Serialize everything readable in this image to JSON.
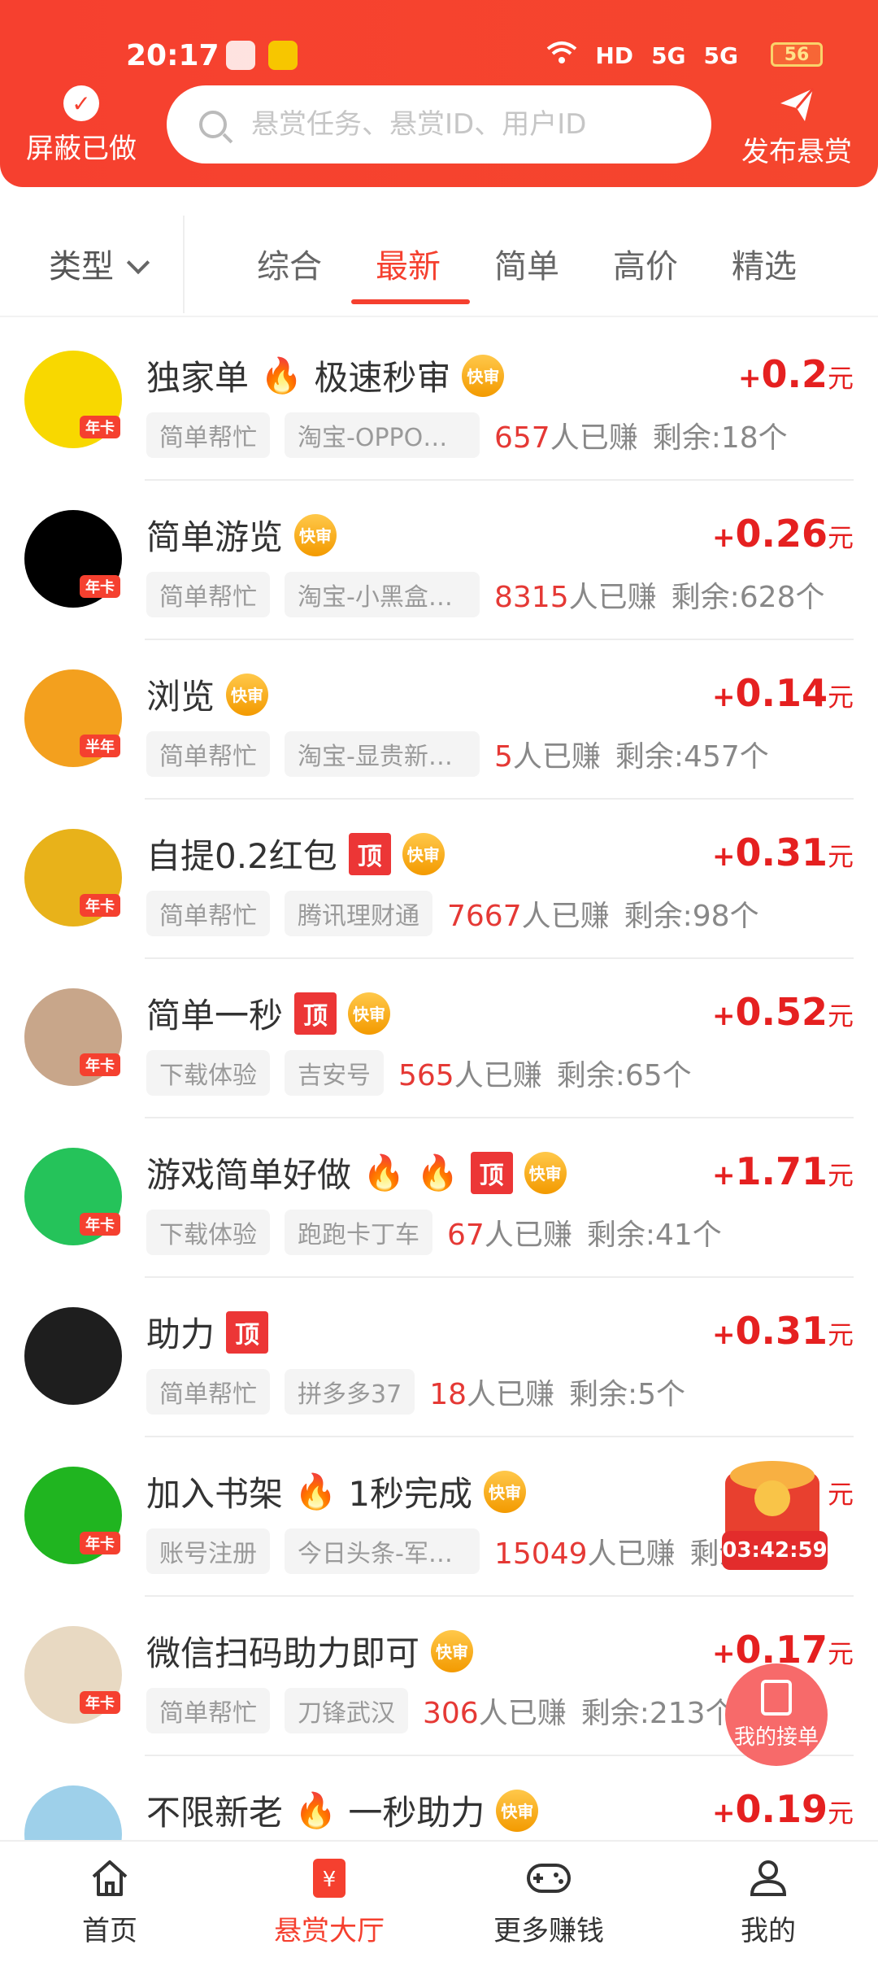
{
  "status": {
    "time": "20:17",
    "battery": "56",
    "network_labels": [
      "HD",
      "5G",
      "5G"
    ]
  },
  "header": {
    "left_label": "屏蔽已做",
    "search_placeholder": "悬赏任务、悬赏ID、用户ID",
    "right_label": "发布悬赏"
  },
  "filter": {
    "type_label": "类型",
    "tabs": [
      "综合",
      "最新",
      "简单",
      "高价",
      "精选"
    ],
    "active_tab": "最新"
  },
  "tasks": [
    {
      "title": "独家单",
      "title2": "极速秒审",
      "fire1": true,
      "fire2": false,
      "top": false,
      "quick": true,
      "tag1": "简单帮忙",
      "tag2": "淘宝-OPPO旗...",
      "earned": "657",
      "earned_suffix": "人已赚",
      "remain": "剩余:18个",
      "price": "0.2",
      "card": "年卡",
      "avatar_color": "#f8d800"
    },
    {
      "title": "简单游览",
      "title2": "",
      "fire1": false,
      "fire2": false,
      "top": false,
      "quick": true,
      "tag1": "简单帮忙",
      "tag2": "淘宝-小黑盒追...",
      "earned": "8315",
      "earned_suffix": "人已赚",
      "remain": "剩余:628个",
      "price": "0.26",
      "card": "年卡",
      "avatar_color": "#000000"
    },
    {
      "title": "浏览",
      "title2": "",
      "fire1": false,
      "fire2": false,
      "top": false,
      "quick": true,
      "tag1": "简单帮忙",
      "tag2": "淘宝-显贵新路...",
      "earned": "5",
      "earned_suffix": "人已赚",
      "remain": "剩余:457个",
      "price": "0.14",
      "card": "半年",
      "avatar_color": "#f3a01e"
    },
    {
      "title": "自提0.2红包",
      "title2": "",
      "fire1": false,
      "fire2": false,
      "top": true,
      "quick": true,
      "tag1": "简单帮忙",
      "tag2": "腾讯理财通",
      "earned": "7667",
      "earned_suffix": "人已赚",
      "remain": "剩余:98个",
      "price": "0.31",
      "card": "年卡",
      "avatar_color": "#e8b21a"
    },
    {
      "title": "简单一秒",
      "title2": "",
      "fire1": false,
      "fire2": false,
      "top": true,
      "quick": true,
      "tag1": "下载体验",
      "tag2": "吉安号",
      "earned": "565",
      "earned_suffix": "人已赚",
      "remain": "剩余:65个",
      "price": "0.52",
      "card": "年卡",
      "avatar_color": "#c8a68a"
    },
    {
      "title": "游戏简单好做",
      "title2": "",
      "fire1": true,
      "fire2": true,
      "top": true,
      "quick": true,
      "tag1": "下载体验",
      "tag2": "跑跑卡丁车",
      "earned": "67",
      "earned_suffix": "人已赚",
      "remain": "剩余:41个",
      "price": "1.71",
      "card": "年卡",
      "avatar_color": "#25c35a"
    },
    {
      "title": "助力",
      "title2": "",
      "fire1": false,
      "fire2": false,
      "top": true,
      "quick": false,
      "tag1": "简单帮忙",
      "tag2": "拼多多37",
      "earned": "18",
      "earned_suffix": "人已赚",
      "remain": "剩余:5个",
      "price": "0.31",
      "card": "",
      "avatar_color": "#1e1e1e"
    },
    {
      "title": "加入书架",
      "title2": "1秒完成",
      "fire1": true,
      "fire2": false,
      "top": false,
      "quick": true,
      "tag1": "账号注册",
      "tag2": "今日头条-军训...",
      "earned": "15049",
      "earned_suffix": "人已赚",
      "remain": "剩余:",
      "price": "",
      "card": "年卡",
      "avatar_color": "#20b520"
    },
    {
      "title": "微信扫码助力即可",
      "title2": "",
      "fire1": false,
      "fire2": false,
      "top": false,
      "quick": true,
      "tag1": "简单帮忙",
      "tag2": "刀锋武汉",
      "earned": "306",
      "earned_suffix": "人已赚",
      "remain": "剩余:213个",
      "price": "0.17",
      "card": "年卡",
      "avatar_color": "#e8d9c2"
    },
    {
      "title": "不限新老",
      "title2": "一秒助力",
      "fire1": true,
      "fire2": false,
      "top": false,
      "quick": true,
      "tag1": "",
      "tag2": "",
      "earned": "",
      "earned_suffix": "",
      "remain": "",
      "price": "0.19",
      "card": "",
      "avatar_color": "#9ed0ea"
    }
  ],
  "labels": {
    "top": "顶",
    "quick": "快审",
    "plus": "+",
    "unit": "元"
  },
  "float": {
    "timer": "03:42:59",
    "my_orders": "我的接单"
  },
  "nav": [
    {
      "label": "首页"
    },
    {
      "label": "悬赏大厅"
    },
    {
      "label": "更多赚钱"
    },
    {
      "label": "我的"
    }
  ],
  "colors": {
    "accent": "#f5402f",
    "price": "#e52020"
  }
}
